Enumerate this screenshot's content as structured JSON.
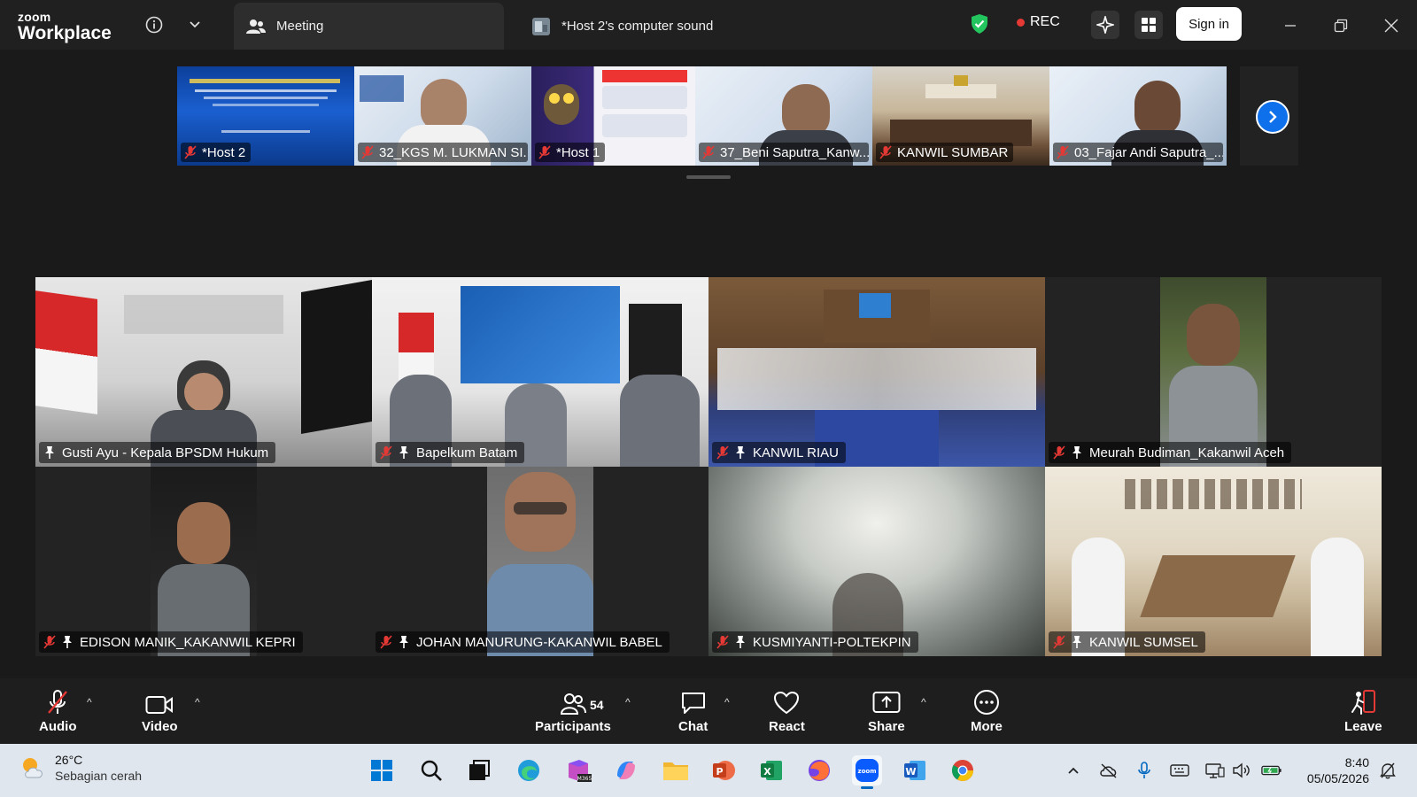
{
  "titlebar": {
    "brand_top": "zoom",
    "brand_bottom": "Workplace",
    "meeting_tab": "Meeting",
    "sound_tab": "*Host 2's computer sound",
    "rec_label": "REC",
    "sign_in": "Sign in"
  },
  "filmstrip": [
    {
      "name": "*Host 2",
      "icon": "mic-off-icon"
    },
    {
      "name": "32_KGS M. LUKMAN SI...",
      "icon": "mic-off-icon"
    },
    {
      "name": "*Host 1",
      "icon": "mic-off-icon"
    },
    {
      "name": "37_Beni Saputra_Kanw...",
      "icon": "mic-off-icon"
    },
    {
      "name": "KANWIL SUMBAR",
      "icon": "mic-off-icon"
    },
    {
      "name": "03_Fajar Andi Saputra_...",
      "icon": "mic-off-icon"
    }
  ],
  "gallery": [
    {
      "name": "Gusti Ayu - Kepala BPSDM Hukum",
      "muted": false
    },
    {
      "name": "Bapelkum Batam",
      "muted": true
    },
    {
      "name": "KANWIL RIAU",
      "muted": true
    },
    {
      "name": "Meurah Budiman_Kakanwil Aceh",
      "muted": true
    },
    {
      "name": "EDISON MANIK_KAKANWIL KEPRI",
      "muted": true
    },
    {
      "name": "JOHAN MANURUNG-KAKANWIL BABEL",
      "muted": true
    },
    {
      "name": "KUSMIYANTI-POLTEKPIN",
      "muted": true
    },
    {
      "name": "KANWIL SUMSEL",
      "muted": true
    }
  ],
  "toolbar": {
    "audio": "Audio",
    "video": "Video",
    "participants": "Participants",
    "participant_count": "54",
    "chat": "Chat",
    "react": "React",
    "share": "Share",
    "more": "More",
    "leave": "Leave"
  },
  "taskbar": {
    "temperature": "26°C",
    "weather_desc": "Sebagian cerah",
    "time": "8:40",
    "date": "05/05/2026"
  },
  "colors": {
    "accent": "#0e71eb",
    "rec": "#e53935",
    "muted_mic": "#e53935",
    "shield": "#22c55e"
  }
}
